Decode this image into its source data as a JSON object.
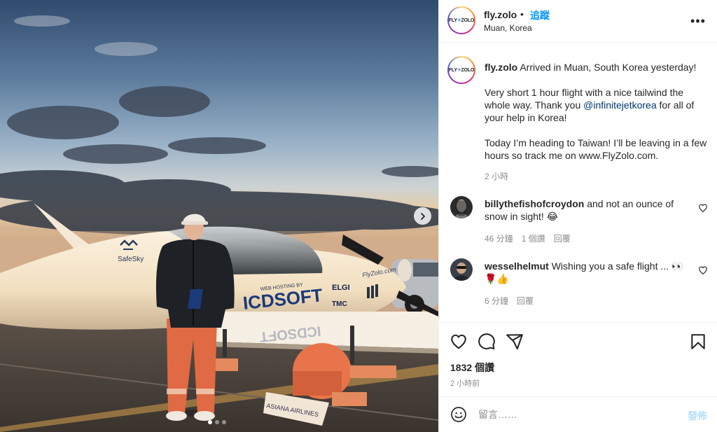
{
  "post": {
    "username": "fly.zolo",
    "separator": "•",
    "follow_label": "追蹤",
    "location": "Muan, Korea",
    "more_label": "•••",
    "avatar_logo": {
      "left": "FLY",
      "right": "ZOLO"
    }
  },
  "photo": {
    "wing_logo_text": "SafeSky",
    "sponsor_small": "WEB HOSTING BY",
    "sponsor_main": "ICDSOFT",
    "sponsor_mirror": "ICDSOFT",
    "fuselage_url": "FlyZolo.com",
    "badge_elgi": "ELGI",
    "badge_tmc": "TMC",
    "cart_label": "ASIANA AIRLINES",
    "carousel_dots": 3,
    "active_dot": 0
  },
  "caption": {
    "username": "fly.zolo",
    "line1": "Arrived in Muan, South Korea yesterday!",
    "p2_before": "Very short 1 hour flight with a nice tailwind the whole way. Thank you ",
    "p2_mention": "@infinitejetkorea",
    "p2_after": " for all of your help in Korea!",
    "p3": "Today I’m heading to Taiwan! I’ll be leaving in a few hours so track me on www.FlyZolo.com.",
    "time": "2 小時"
  },
  "comments": [
    {
      "username": "billythefishofcroydon",
      "text": "and not an ounce of snow in sight! 😂",
      "time": "46 分鐘",
      "likes": "1 個讚",
      "reply": "回覆"
    },
    {
      "username": "wesselhelmut",
      "text": "Wishing you a safe flight ... 👀🌹👍",
      "time": "6 分鐘",
      "reply": "回覆"
    }
  ],
  "engagement": {
    "likes": "1832 個讚",
    "posted": "2 小時前"
  },
  "comment_bar": {
    "placeholder": "留言……",
    "post_label": "發佈"
  },
  "colors": {
    "accent": "#0095f6",
    "mention": "#00376b",
    "muted": "#8e8e8e",
    "text": "#262626",
    "post_disabled": "#b2dffc"
  }
}
